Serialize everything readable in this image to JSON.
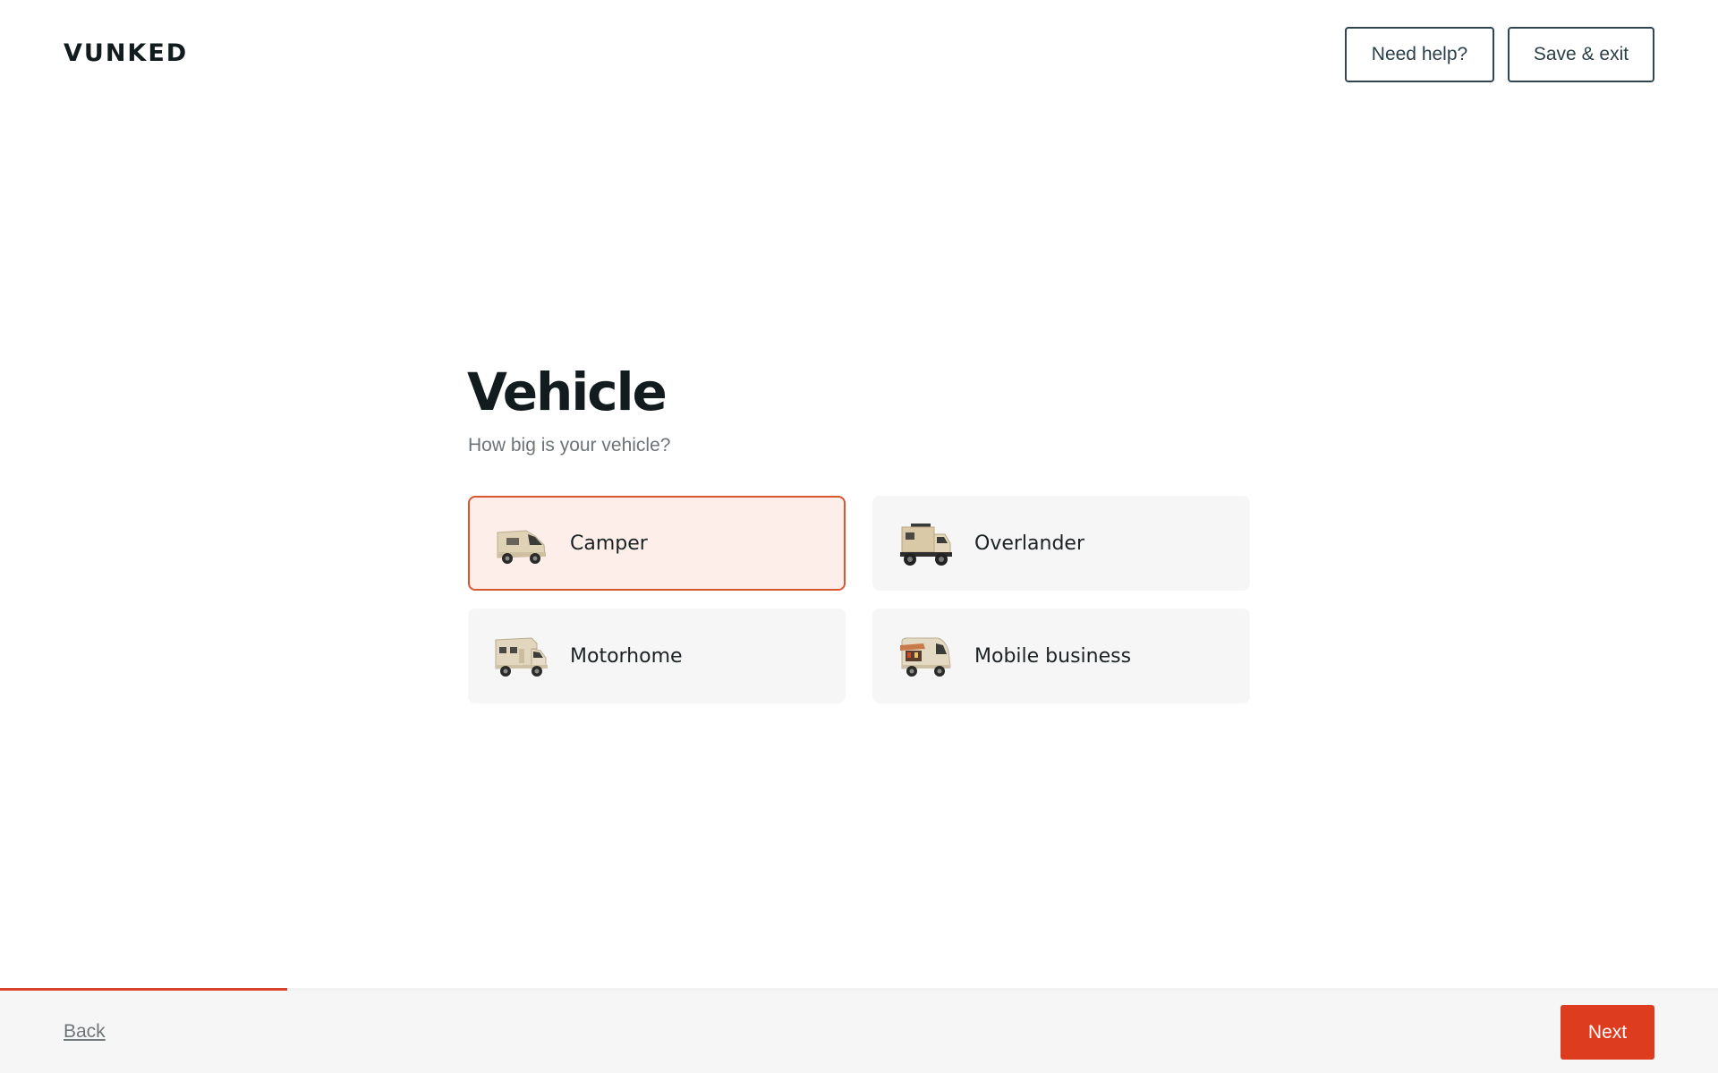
{
  "brand": {
    "logo_text": "VUNKED"
  },
  "header": {
    "help_label": "Need help?",
    "save_exit_label": "Save & exit"
  },
  "main": {
    "title": "Vehicle",
    "subtitle": "How big is your vehicle?",
    "options": [
      {
        "label": "Camper",
        "icon": "camper-van-icon",
        "selected": true
      },
      {
        "label": "Overlander",
        "icon": "overlander-truck-icon",
        "selected": false
      },
      {
        "label": "Motorhome",
        "icon": "motorhome-icon",
        "selected": false
      },
      {
        "label": "Mobile business",
        "icon": "food-truck-icon",
        "selected": false
      }
    ]
  },
  "footer": {
    "back_label": "Back",
    "next_label": "Next",
    "progress_fraction": 0.167
  },
  "colors": {
    "accent": "#dd3c1f",
    "selected_bg": "#fdeeea",
    "selected_border": "#d9572f",
    "card_bg": "#f6f6f6"
  }
}
